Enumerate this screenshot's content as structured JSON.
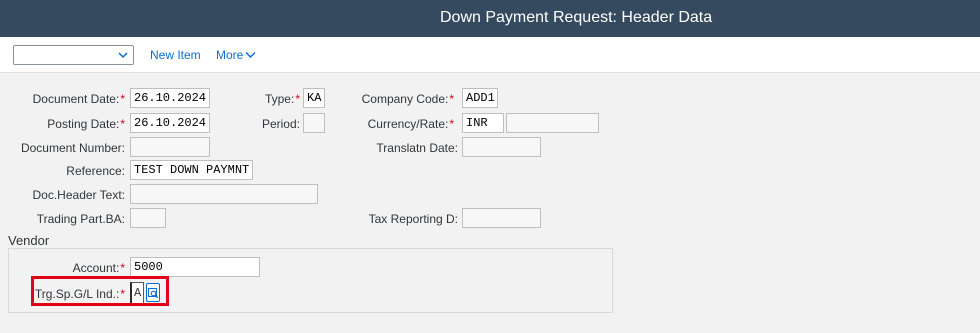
{
  "header": {
    "title": "Down Payment Request: Header Data"
  },
  "toolbar": {
    "dropdown_value": "",
    "new_item_label": "New Item",
    "more_label": "More"
  },
  "form": {
    "document_date": {
      "label": "Document Date:",
      "value": "26.10.2024"
    },
    "type": {
      "label": "Type:",
      "value": "KA"
    },
    "company_code": {
      "label": "Company Code:",
      "value": "ADD1"
    },
    "posting_date": {
      "label": "Posting Date:",
      "value": "26.10.2024"
    },
    "period": {
      "label": "Period:",
      "value": ""
    },
    "currency_rate": {
      "label": "Currency/Rate:",
      "value": "INR",
      "rate_value": ""
    },
    "document_number": {
      "label": "Document Number:",
      "value": ""
    },
    "translatn_date": {
      "label": "Translatn Date:",
      "value": ""
    },
    "reference": {
      "label": "Reference:",
      "value": "TEST DOWN PAYMNT"
    },
    "doc_header_text": {
      "label": "Doc.Header Text:",
      "value": ""
    },
    "trading_part_ba": {
      "label": "Trading Part.BA:",
      "value": ""
    },
    "tax_reporting_d": {
      "label": "Tax Reporting D:",
      "value": ""
    }
  },
  "vendor": {
    "section_title": "Vendor",
    "account": {
      "label": "Account:",
      "value": "5000"
    },
    "trg_sp_gl_ind": {
      "label": "Trg.Sp.G/L Ind.:",
      "value": "A"
    }
  },
  "colors": {
    "title_bar": "#354a5f",
    "link": "#0a6ed1",
    "required": "#d0021b",
    "highlight": "#e3001b"
  },
  "icons": {
    "dropdown": "chevron-down-icon",
    "more": "chevron-down-icon",
    "value_help": "value-help-icon"
  }
}
